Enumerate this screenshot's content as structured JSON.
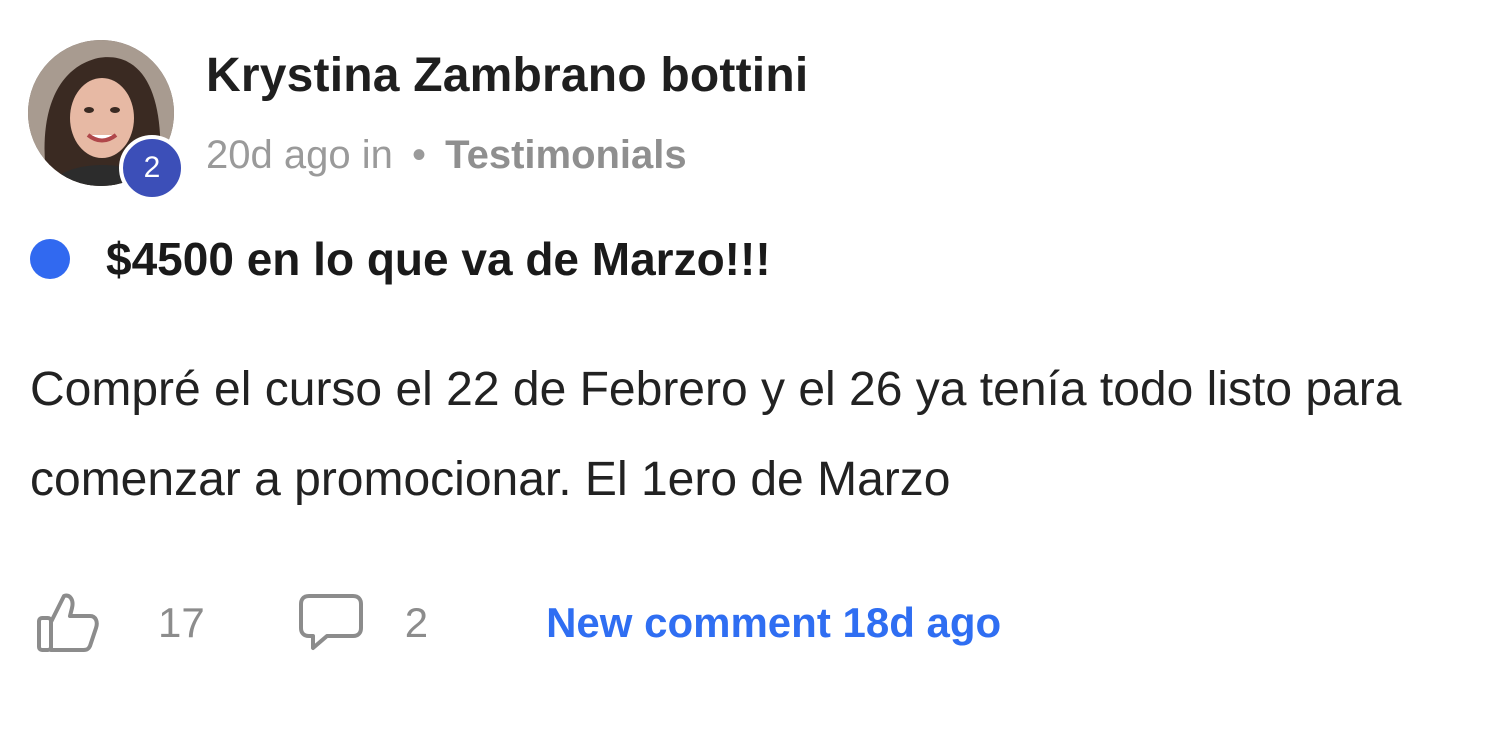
{
  "author": {
    "name": "Krystina Zambrano bottini",
    "level": "2"
  },
  "meta": {
    "time": "20d ago in",
    "separator": "•",
    "category": "Testimonials"
  },
  "post": {
    "title": "$4500 en lo que va de Marzo!!!",
    "body": "Compré el curso el 22 de Febrero y el 26 ya tenía todo listo para comenzar a promocionar. El 1ero de Marzo"
  },
  "actions": {
    "like_icon": "thumbs-up-icon",
    "likes": "17",
    "comment_icon": "comment-bubble-icon",
    "comments": "2",
    "new_comment": "New comment 18d ago"
  },
  "colors": {
    "accent_blue": "#2f6ef2",
    "unread_dot": "#3169f0",
    "level_badge": "#3c4fb8",
    "muted_text": "#9a9a9a"
  }
}
